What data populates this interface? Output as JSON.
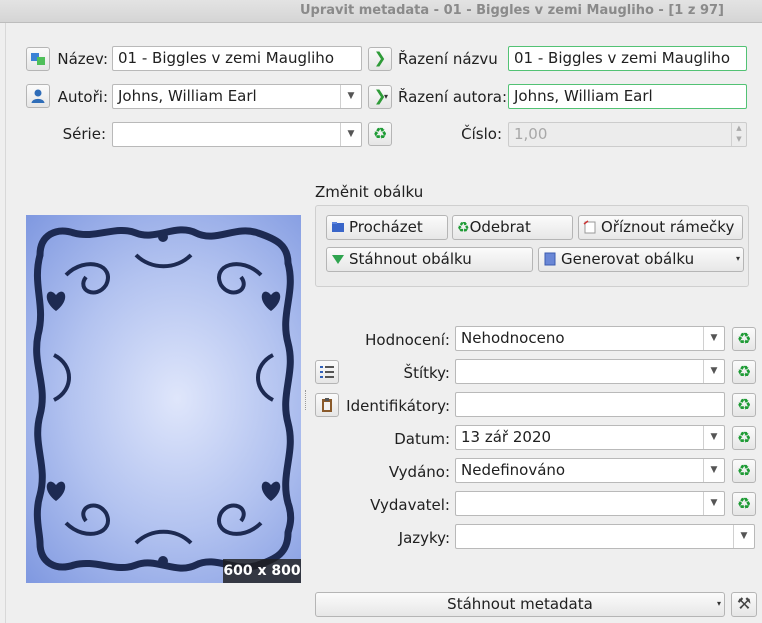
{
  "window": {
    "title": "Upravit metadata - 01 - Biggles v zemi Maugliho - [1 z 97]"
  },
  "title_row": {
    "label": "Název:",
    "value": "01 - Biggles v zemi Maugliho",
    "sort_label": "Řazení názvu",
    "sort_value": "01 - Biggles v zemi Maugliho"
  },
  "authors_row": {
    "label": "Autoři:",
    "value": "Johns, William Earl",
    "sort_label": "Řazení autora:",
    "sort_value": "Johns, William Earl"
  },
  "series_row": {
    "label": "Série:",
    "value": "",
    "number_label": "Číslo:",
    "number_value": "1,00"
  },
  "cover": {
    "group_title": "Změnit obálku",
    "browse": "Procházet",
    "remove": "Odebrat",
    "trim": "Oříznout rámečky",
    "download": "Stáhnout obálku",
    "generate": "Generovat obálku",
    "size_badge": "600 x 800"
  },
  "fields": {
    "rating": {
      "label": "Hodnocení:",
      "value": "Nehodnoceno"
    },
    "tags": {
      "label": "Štítky:",
      "value": ""
    },
    "identifiers": {
      "label": "Identifikátory:",
      "value": ""
    },
    "date": {
      "label": "Datum:",
      "value": "13 zář 2020"
    },
    "published": {
      "label": "Vydáno:",
      "value": "Nedefinováno"
    },
    "publisher": {
      "label": "Vydavatel:",
      "value": ""
    },
    "languages": {
      "label": "Jazyky:",
      "value": ""
    }
  },
  "bottom": {
    "download_metadata": "Stáhnout metadata"
  },
  "colors": {
    "accent_green": "#52c274",
    "cover_blue": "#9fb3ec",
    "frame_navy": "#1d2a52"
  }
}
